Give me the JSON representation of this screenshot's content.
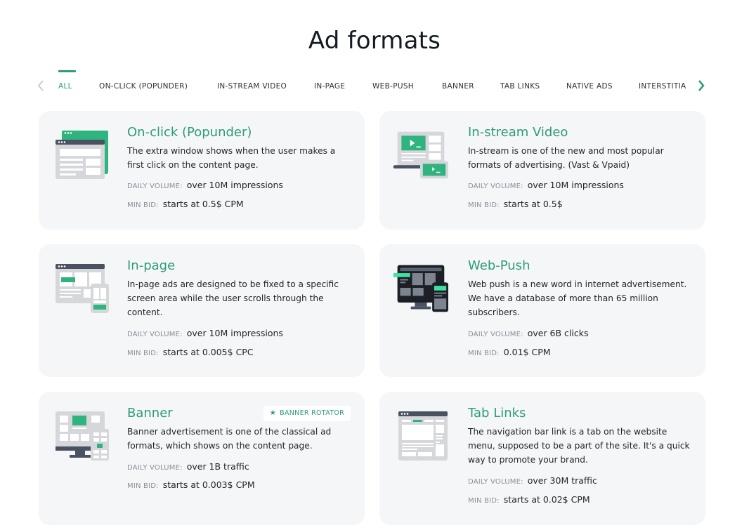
{
  "page": {
    "title": "Ad formats"
  },
  "colors": {
    "accent": "#2e9c76",
    "card_bg": "#f5f6f8",
    "label": "#8a8f98",
    "text": "#1f2328"
  },
  "tabs": {
    "prev_icon": "chevron-left-icon",
    "next_icon": "chevron-right-icon",
    "items": [
      {
        "label": "ALL",
        "active": true
      },
      {
        "label": "ON-CLICK (POPUNDER)"
      },
      {
        "label": "IN-STREAM VIDEO"
      },
      {
        "label": "IN-PAGE"
      },
      {
        "label": "WEB-PUSH"
      },
      {
        "label": "BANNER"
      },
      {
        "label": "TAB LINKS"
      },
      {
        "label": "NATIVE ADS"
      },
      {
        "label": "INTERSTITIA"
      }
    ]
  },
  "labels": {
    "daily_volume": "DAILY VOLUME:",
    "min_bid": "MIN BID:"
  },
  "cards": [
    {
      "title": "On-click (Popunder)",
      "icon": "popunder-windows-icon",
      "description": "The extra window shows when the user makes a first click on the content page.",
      "daily_volume": "over 10M impressions",
      "min_bid": "starts at 0.5$ CPM"
    },
    {
      "title": "In-stream Video",
      "icon": "video-laptop-icon",
      "description": "In-stream is one of the new and most popular formats of advertising. (Vast & Vpaid)",
      "daily_volume": "over 10M impressions",
      "min_bid": "starts at 0.5$"
    },
    {
      "title": "In-page",
      "icon": "in-page-browser-icon",
      "description": "In-page ads are designed to be fixed to a specific screen area while the user scrolls through the content.",
      "daily_volume": "over 10M impressions",
      "min_bid": "starts at 0.005$ CPC"
    },
    {
      "title": "Web-Push",
      "icon": "web-push-monitor-icon",
      "description": "Web push is a new word in internet advertisement. We have a database of more than 65 million subscribers.",
      "daily_volume": "over 6B clicks",
      "min_bid": "0.01$ CPM"
    },
    {
      "title": "Banner",
      "icon": "banner-monitor-icon",
      "description": "Banner advertisement is one of the classical ad formats, which shows on the content page.",
      "daily_volume": "over 1B traffic",
      "min_bid": "starts at 0.003$ CPM",
      "badge": {
        "icon": "star-icon",
        "label": "BANNER ROTATOR"
      }
    },
    {
      "title": "Tab Links",
      "icon": "tab-links-browser-icon",
      "description": "The navigation bar link is a tab on the website menu, supposed to be a part of the site. It's a quick way to promote your brand.",
      "daily_volume": "over 30M traffic",
      "min_bid": "starts at 0.02$ CPM"
    }
  ]
}
